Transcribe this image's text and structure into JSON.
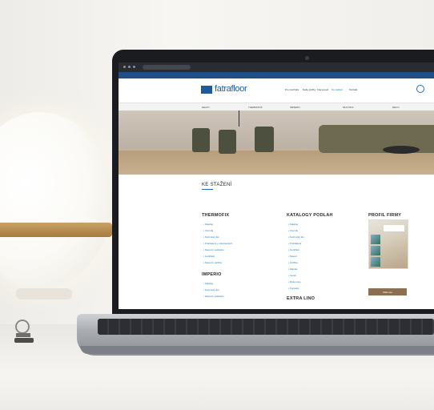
{
  "website": {
    "brand": "fatrafloor",
    "top_nav": [
      "Pro návrháře",
      "Naše služby",
      "Kde koupit",
      "Ke stažení",
      "Kontakt"
    ],
    "active_top_nav": "Ke stažení",
    "categories": [
      "HEAVY",
      "THERMOFIX",
      "IMPERIO",
      "MULTIFIX",
      "DECO"
    ],
    "section_heading": "KE STAŽENÍ",
    "columns": [
      {
        "title": "THERMOFIX",
        "links": [
          "Katalog",
          "Vzorník",
          "Technický list",
          "Prohlášení o vlastnostech",
          "Návod k pokládce",
          "Certifikát",
          "Návod k údržbě"
        ]
      },
      {
        "title": "IMPERIO",
        "links": [
          "Katalog",
          "Technický list",
          "Návod k pokládce"
        ]
      },
      {
        "title": "KATALOGY PODLAH",
        "links": [
          "Katalog",
          "Vzorník",
          "Technický list",
          "Prohlášení",
          "Certifikát",
          "Návod",
          "Údržba",
          "Záruka",
          "Ceník",
          "Reference",
          "Kontakty"
        ]
      },
      {
        "title": "EXTRA LINO",
        "links": []
      },
      {
        "title": "PROFIL FIRMY",
        "links": []
      }
    ],
    "profile_button": "Stáhnout"
  },
  "colors": {
    "brand_blue": "#1f5a9a",
    "link_blue": "#2f77c4",
    "button_brown": "#8b6f4e",
    "lamp_brass": "#b88a4d"
  }
}
